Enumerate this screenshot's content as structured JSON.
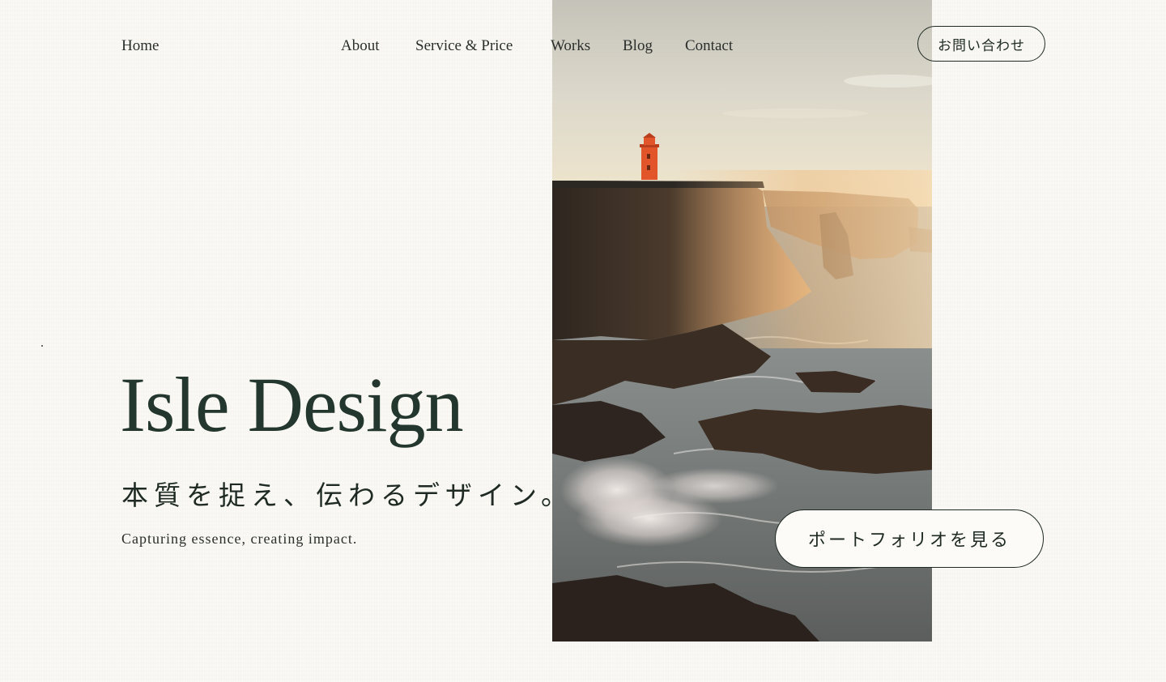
{
  "nav": {
    "home": "Home",
    "about": "About",
    "service": "Service & Price",
    "works": "Works",
    "blog": "Blog",
    "contact": "Contact",
    "contact_button": "お問い合わせ"
  },
  "hero": {
    "title": "Isle Design",
    "tagline_jp": "本質を捉え、伝わるデザイン。",
    "tagline_en": "Capturing essence, creating impact.",
    "portfolio_button": "ポートフォリオを見る",
    "photo_subject": "lighthouse-on-coastal-cliffs"
  },
  "colors": {
    "background": "#f8f7f2",
    "title": "#23372e",
    "text": "#1f2a24",
    "lighthouse": "#e2552a"
  }
}
